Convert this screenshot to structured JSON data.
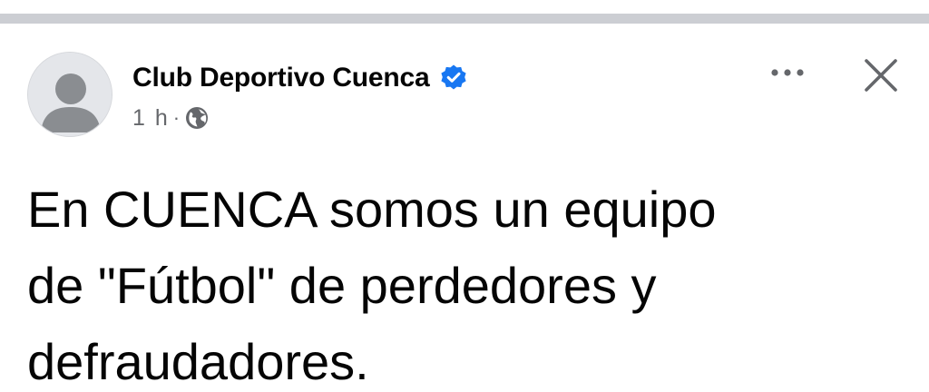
{
  "post": {
    "author": "Club Deportivo Cuenca",
    "verified_icon": "verified-badge-icon",
    "time": "1 h",
    "separator": "·",
    "audience_icon": "globe-icon",
    "body_line1": "En CUENCA somos un equipo",
    "body_line2": "de \"Fútbol\" de perdedores y",
    "body_line3": "defraudadores.",
    "more_icon": "more-options-icon",
    "close_icon": "close-icon"
  },
  "colors": {
    "verified": "#1877f2",
    "text": "#050505",
    "meta": "#65676b",
    "divider": "#ccced3"
  }
}
